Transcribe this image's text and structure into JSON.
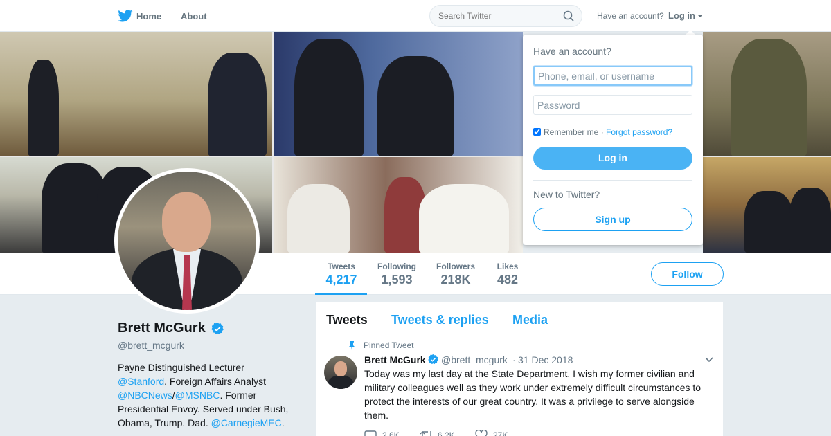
{
  "nav": {
    "home_label": "Home",
    "about_label": "About",
    "search_placeholder": "Search Twitter",
    "have_account_label": "Have an account?",
    "login_label": "Log in"
  },
  "login_dropdown": {
    "title": "Have an account?",
    "username_placeholder": "Phone, email, or username",
    "password_placeholder": "Password",
    "remember_label": "Remember me",
    "separator": "·",
    "forgot_label": "Forgot password?",
    "login_button": "Log in",
    "new_label": "New to Twitter?",
    "signup_button": "Sign up"
  },
  "stats": [
    {
      "label": "Tweets",
      "value": "4,217"
    },
    {
      "label": "Following",
      "value": "1,593"
    },
    {
      "label": "Followers",
      "value": "218K"
    },
    {
      "label": "Likes",
      "value": "482"
    }
  ],
  "follow_label": "Follow",
  "profile": {
    "name": "Brett McGurk",
    "handle": "@brett_mcgurk",
    "bio": {
      "line1": "Payne Distinguished Lecturer",
      "stanford": "@Stanford",
      "text2": ". Foreign Affairs Analyst",
      "nbc": "@NBCNews",
      "slash": "/",
      "msnbc": "@MSNBC",
      "text3": ". Former Presidential Envoy. Served under Bush, Obama, Trump. Dad. ",
      "carnegie": "@CarnegieMEC",
      "end": "."
    }
  },
  "timeline": {
    "tabs": [
      "Tweets",
      "Tweets & replies",
      "Media"
    ],
    "pinned_label": "Pinned Tweet",
    "tweet": {
      "name": "Brett McGurk",
      "handle": "@brett_mcgurk",
      "dot": "·",
      "date": "31 Dec 2018",
      "text": "Today was my last day at the State Department. I wish my former civilian and military colleagues well as they work under extremely difficult circumstances to protect the interests of our great country. It was a privilege to serve alongside them.",
      "replies": "2.6K",
      "retweets": "6.2K",
      "likes": "27K"
    }
  },
  "colors": {
    "accent": "#1da1f2",
    "text": "#14171a",
    "muted": "#657786",
    "background": "#e6ecf0"
  }
}
